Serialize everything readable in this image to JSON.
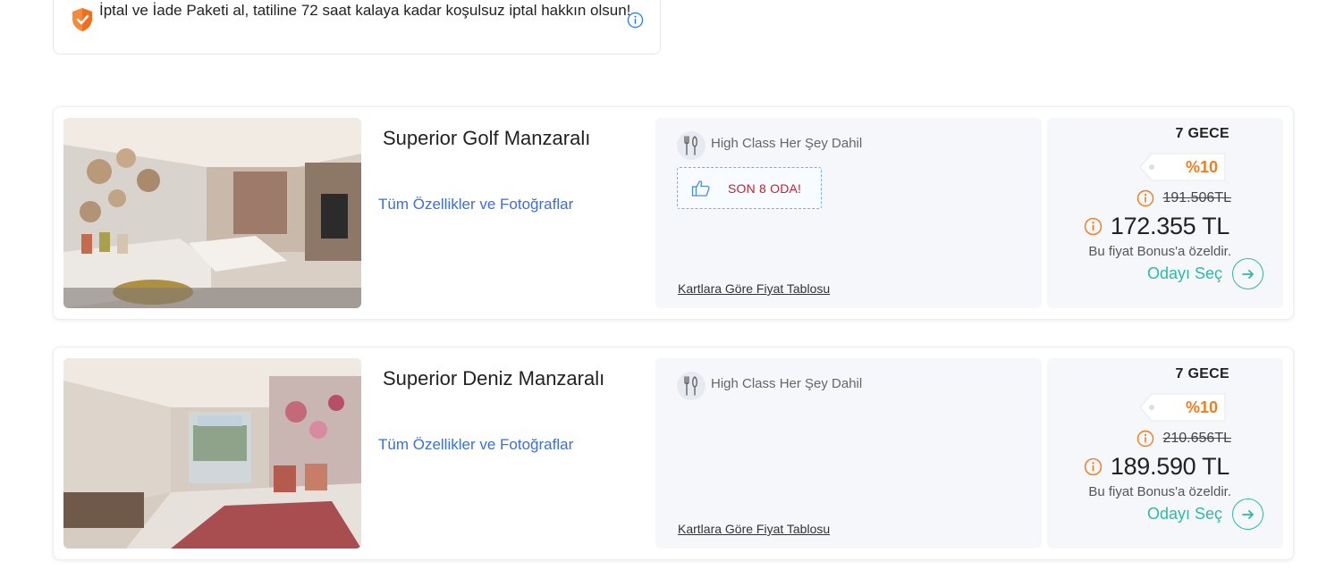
{
  "notice": {
    "text": "İptal ve İade Paketi al, tatiline 72 saat kalaya kadar koşulsuz iptal hakkın olsun!"
  },
  "rooms": [
    {
      "name": "Superior Golf Manzaralı",
      "features_link": "Tüm Özellikler ve Fotoğraflar",
      "board": "High Class Her Şey Dahil",
      "stock_badge": "SON 8 ODA!",
      "price_table_link": "Kartlara Göre Fiyat Tablosu",
      "nights": "7 GECE",
      "discount": "%10",
      "old_price": "191.506TL",
      "new_price": "172.355 TL",
      "bonus_note": "Bu fiyat Bonus'a özeldir.",
      "select_label": "Odayı Seç"
    },
    {
      "name": "Superior Deniz Manzaralı",
      "features_link": "Tüm Özellikler ve Fotoğraflar",
      "board": "High Class Her Şey Dahil",
      "price_table_link": "Kartlara Göre Fiyat Tablosu",
      "nights": "7 GECE",
      "discount": "%10",
      "old_price": "210.656TL",
      "new_price": "189.590 TL",
      "bonus_note": "Bu fiyat Bonus'a özeldir.",
      "select_label": "Odayı Seç"
    }
  ],
  "colors": {
    "link_blue": "#3b6fd9",
    "accent_orange": "#f07d1e",
    "select_teal": "#2fb9a6",
    "stock_red": "#c0252c",
    "panel_bg": "#f5f7fb"
  },
  "icons": {
    "notice": "shield-check-icon",
    "notice_info": "info-icon",
    "board": "cutlery-icon",
    "stock": "thumbs-up-icon",
    "price_info": "info-circle-icon",
    "select": "arrow-right-circle-icon"
  }
}
